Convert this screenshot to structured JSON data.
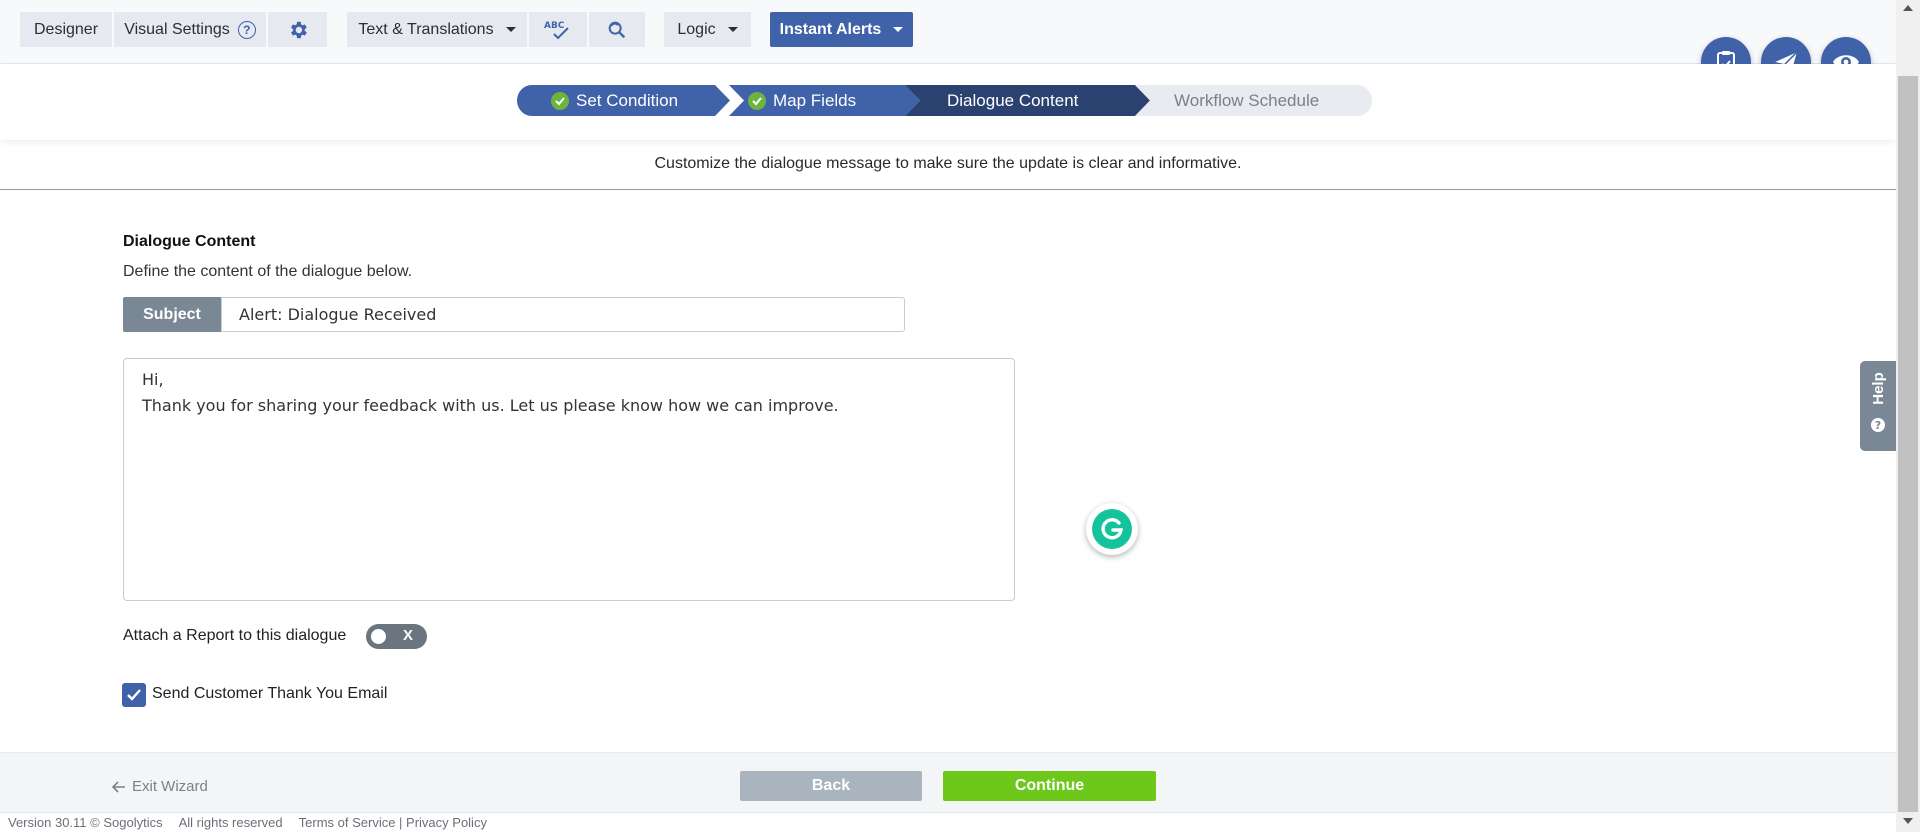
{
  "toolbar": {
    "designer": "Designer",
    "visual_settings": "Visual Settings",
    "text_translations": "Text & Translations",
    "spellcheck_abc": "ABC",
    "logic": "Logic",
    "instant_alerts": "Instant Alerts"
  },
  "stepper": {
    "steps": [
      {
        "label": "Set Condition",
        "state": "done"
      },
      {
        "label": "Map Fields",
        "state": "done"
      },
      {
        "label": "Dialogue Content",
        "state": "active"
      },
      {
        "label": "Workflow Schedule",
        "state": "pending"
      }
    ]
  },
  "instruction": "Customize the dialogue message to make sure the update is clear and informative.",
  "form": {
    "section_title": "Dialogue Content",
    "section_desc": "Define the content of the dialogue below.",
    "subject_label": "Subject",
    "subject_value": "Alert: Dialogue Received",
    "body_line1": "Hi,",
    "body_line2": "Thank you for sharing your feedback with us. Let us please know how we can improve.",
    "attach_label": "Attach a Report to this dialogue",
    "toggle_off_glyph": "X",
    "send_email_label": "Send Customer Thank You Email",
    "send_email_checked": true
  },
  "help_tab": "Help",
  "footer": {
    "exit": "Exit Wizard",
    "back": "Back",
    "continue": "Continue"
  },
  "bottom": {
    "version": "Version 30.11 © Sogolytics",
    "rights": "All rights reserved",
    "terms": "Terms of Service | Privacy Policy"
  },
  "colors": {
    "primary": "#3f62a9",
    "step_active": "#2b4170",
    "step_done": "#3f62a9",
    "step_pending": "#e8ebef",
    "continue": "#6ec81b",
    "back": "#a9b4bf",
    "grammarly": "#15c39a"
  }
}
